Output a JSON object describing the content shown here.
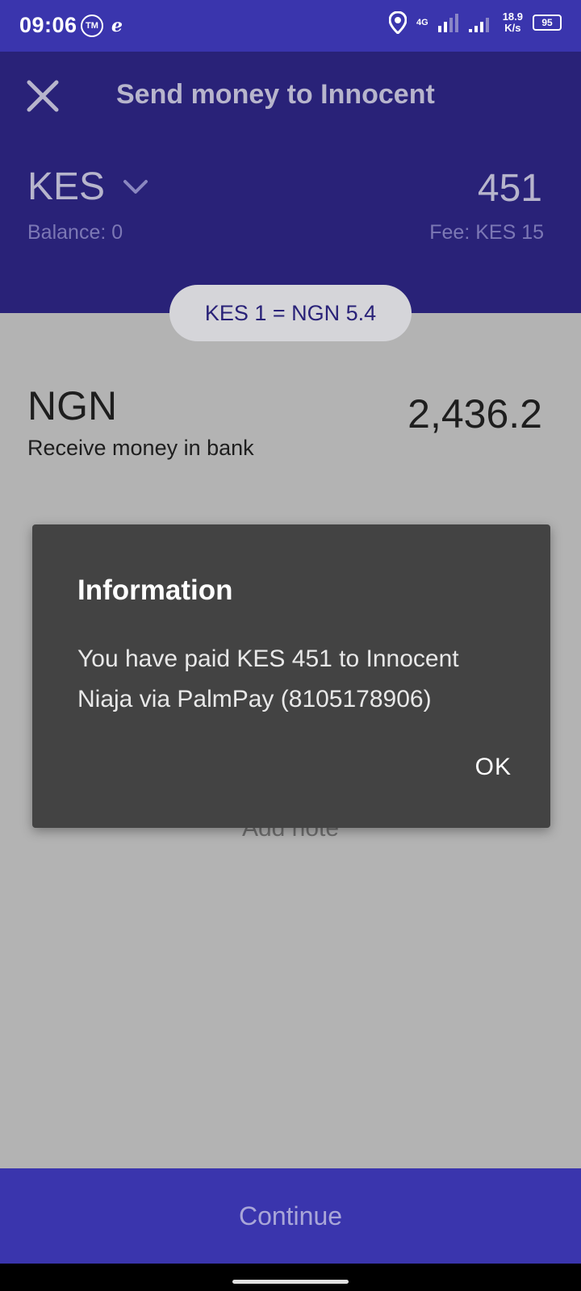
{
  "status_bar": {
    "time": "09:06",
    "tm_badge": "TM",
    "network_type": "4G",
    "net_speed_value": "18.9",
    "net_speed_unit": "K/s",
    "battery": "95"
  },
  "header": {
    "title": "Send money to Innocent",
    "send_currency": "KES",
    "send_amount": "451",
    "balance": "Balance: 0",
    "fee": "Fee: KES 15"
  },
  "exchange_rate": "KES 1 = NGN 5.4",
  "receive": {
    "currency": "NGN",
    "amount": "2,436.2",
    "method_label": "Receive money in bank"
  },
  "add_note_label": "Add note",
  "dialog": {
    "title": "Information",
    "message": "You have paid KES 451 to Innocent Niaja via PalmPay (8105178906)",
    "ok_label": "OK"
  },
  "continue_label": "Continue",
  "colors": {
    "status_bar": "#3a35ad",
    "header": "#292278",
    "dialog": "#434343",
    "overlay_bg": "#b3b3b3"
  }
}
